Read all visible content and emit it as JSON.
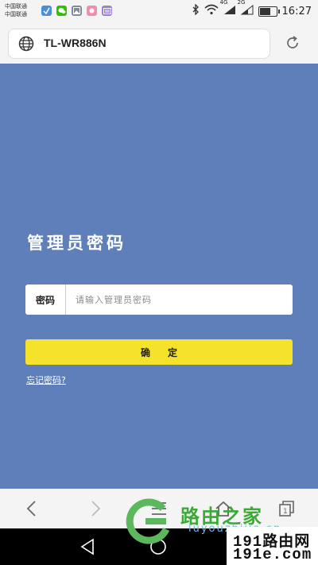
{
  "status_bar": {
    "carrier_1": "中国联通",
    "carrier_2": "中国联通",
    "network_1": "4G",
    "network_2": "2G",
    "time": "16:27",
    "battery_level": 0.75,
    "notification_icons": [
      "app-notify-icon",
      "wechat-icon",
      "gallery-icon",
      "app-notify-icon",
      "keyboard-icon"
    ]
  },
  "browser": {
    "url": "TL-WR886N",
    "address_icon": "globe-icon",
    "reload_icon": "reload-icon"
  },
  "login": {
    "title": "管理员密码",
    "password_label": "密码",
    "password_placeholder": "请输入管理员密码",
    "password_value": "",
    "confirm_label": "确定",
    "forgot_link": "忘记密码?"
  },
  "toolbar": {
    "icons": [
      "back-icon",
      "forward-icon",
      "menu-icon",
      "home-icon",
      "tabs-icon"
    ]
  },
  "watermark": {
    "text_cn": "路由之家",
    "text_url": "luyouzhijia.cn"
  },
  "site_logo": {
    "line1": "191路由网",
    "line2": "191e.com"
  },
  "colors": {
    "page_background": "#5e7fba",
    "confirm_button": "#f5e22a",
    "watermark_green": "#3aaa35"
  }
}
